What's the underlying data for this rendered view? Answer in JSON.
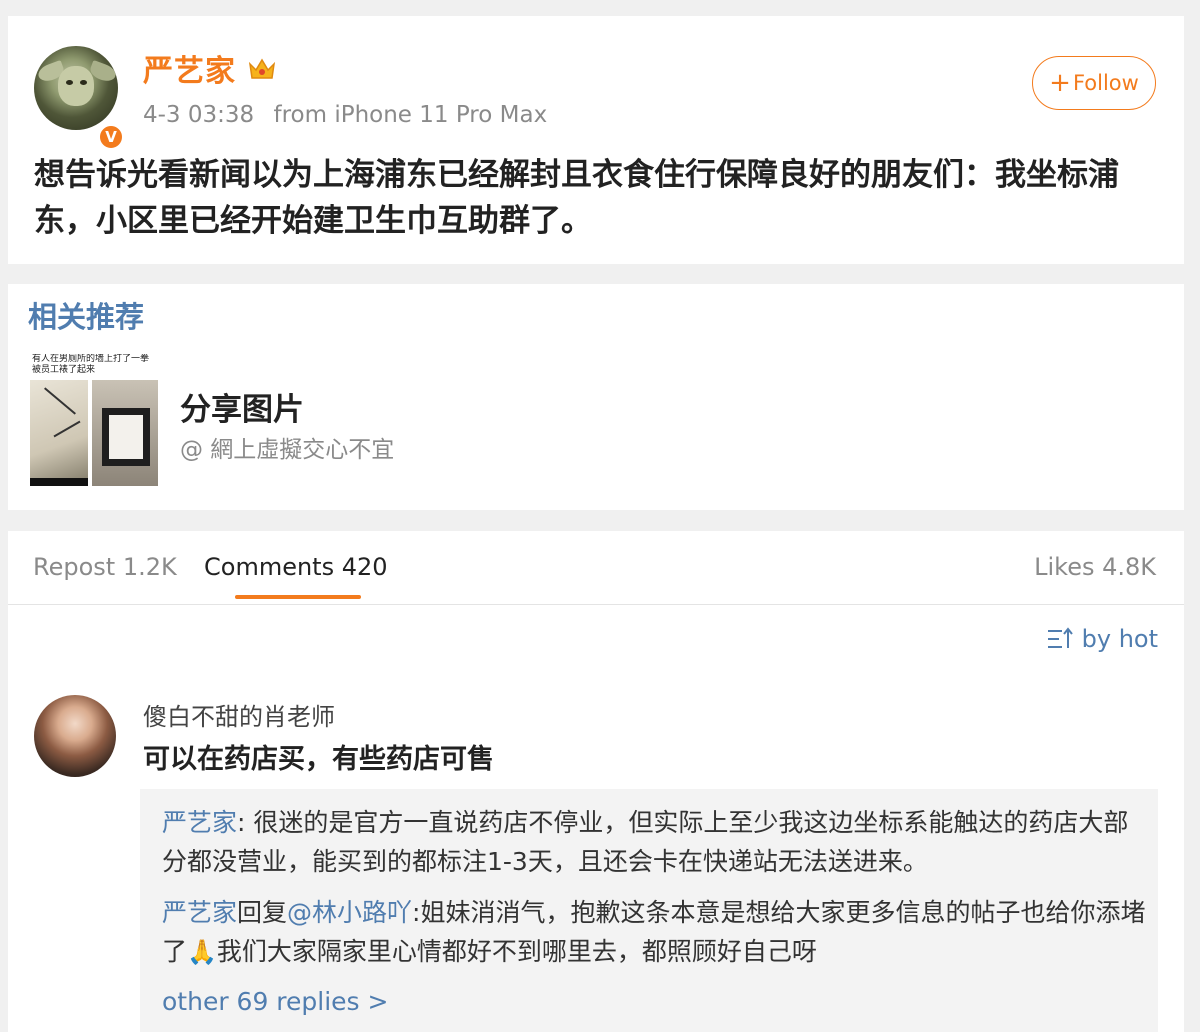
{
  "post": {
    "username": "严艺家",
    "time": "4-3 03:38",
    "source": "from iPhone 11 Pro Max",
    "follow_label": "Follow",
    "verified_badge": "V",
    "text": "想告诉光看新闻以为上海浦东已经解封且衣食住行保障良好的朋友们：我坐标浦东，小区里已经开始建卫生巾互助群了。"
  },
  "related": {
    "title": "相关推荐",
    "thumb_caption": "有人在男厕所的墙上打了一拳 被员工裱了起来",
    "item_title": "分享图片",
    "item_author": "@ 網上虛擬交心不宜"
  },
  "tabs": {
    "repost": "Repost 1.2K",
    "comments": "Comments 420",
    "likes": "Likes 4.8K"
  },
  "sort_label": "by hot",
  "comment": {
    "author": "傻白不甜的肖老师",
    "text": "可以在药店买，有些药店可售",
    "replies": [
      {
        "author": "严艺家",
        "sep": ": ",
        "text": "很迷的是官方一直说药店不停业，但实际上至少我这边坐标系能触达的药店大部分都没营业，能买到的都标注1-3天，且还会卡在快递站无法送进来。"
      },
      {
        "author": "严艺家",
        "reply_word": "回复",
        "mention": "@林小路吖",
        "text_before_emoji": ":姐妹消消气，抱歉这条本意是想给大家更多信息的帖子也给你添堵了",
        "emoji": "🙏",
        "text_after_emoji": "我们大家隔家里心情都好不到哪里去，都照顾好自己呀"
      }
    ],
    "more_replies": "other 69 replies >"
  },
  "colors": {
    "accent_orange": "#f37b1d",
    "link_blue": "#507daf",
    "background": "#f0f0f0"
  },
  "icons": [
    "crown-icon",
    "verified-badge-icon",
    "plus-icon",
    "sort-icon",
    "pray-emoji"
  ]
}
